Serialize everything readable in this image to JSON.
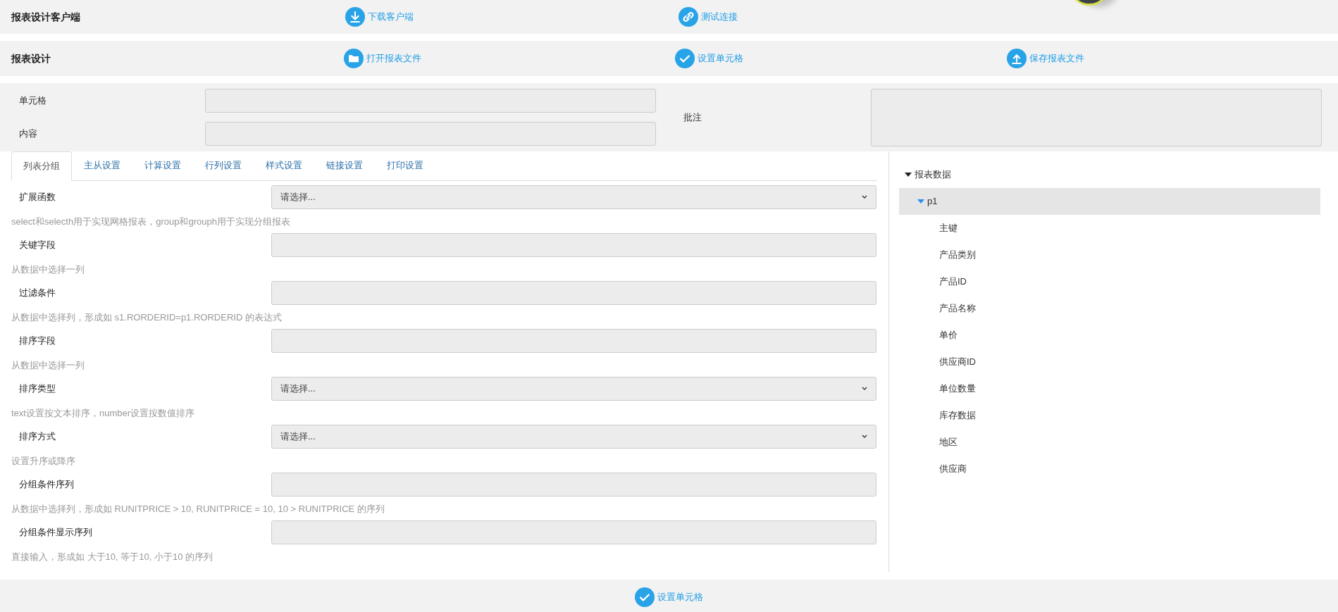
{
  "toolbars": [
    {
      "title": "报表设计客户端",
      "actions": [
        {
          "kind": "download",
          "label": "下载客户端"
        },
        {
          "kind": "link",
          "label": "测试连接"
        }
      ]
    },
    {
      "title": "报表设计",
      "actions": [
        {
          "kind": "folder",
          "label": "打开报表文件"
        },
        {
          "kind": "check",
          "label": "设置单元格"
        },
        {
          "kind": "upload",
          "label": "保存报表文件"
        }
      ]
    }
  ],
  "cell_form": {
    "cell_label": "单元格",
    "content_label": "内容",
    "note_label": "批注"
  },
  "tabs": [
    {
      "label": "列表分组",
      "selected": true
    },
    {
      "label": "主从设置",
      "selected": false
    },
    {
      "label": "计算设置",
      "selected": false
    },
    {
      "label": "行列设置",
      "selected": false
    },
    {
      "label": "样式设置",
      "selected": false
    },
    {
      "label": "链接设置",
      "selected": false
    },
    {
      "label": "打印设置",
      "selected": false
    }
  ],
  "fields": [
    {
      "kind": "select",
      "label": "扩展函数",
      "value": "请选择...",
      "hint": "select和selecth用于实现网格报表，group和grouph用于实现分组报表"
    },
    {
      "kind": "input",
      "label": "关键字段",
      "hint": "从数据中选择一列"
    },
    {
      "kind": "input",
      "label": "过滤条件",
      "hint": "从数据中选择列，形成如 s1.RORDERID=p1.RORDERID 的表达式"
    },
    {
      "kind": "input",
      "label": "排序字段",
      "hint": "从数据中选择一列"
    },
    {
      "kind": "select",
      "label": "排序类型",
      "value": "请选择...",
      "hint": "text设置按文本排序，number设置按数值排序"
    },
    {
      "kind": "select",
      "label": "排序方式",
      "value": "请选择...",
      "hint": "设置升序或降序"
    },
    {
      "kind": "input",
      "label": "分组条件序列",
      "hint": "从数据中选择列，形成如 RUNITPRICE > 10, RUNITPRICE = 10, 10 > RUNITPRICE 的序列"
    },
    {
      "kind": "input",
      "label": "分组条件显示序列",
      "hint": "直接输入，形成如 大于10, 等于10, 小于10 的序列"
    }
  ],
  "tree": {
    "label": "报表数据",
    "expanded": true,
    "children": [
      {
        "label": "p1",
        "expanded": true,
        "selected": true,
        "children": [
          {
            "label": "主键"
          },
          {
            "label": "产品类别"
          },
          {
            "label": "产品ID"
          },
          {
            "label": "产品名称"
          },
          {
            "label": "单价"
          },
          {
            "label": "供应商ID"
          },
          {
            "label": "单位数量"
          },
          {
            "label": "库存数据"
          },
          {
            "label": "地区"
          },
          {
            "label": "供应商"
          }
        ]
      }
    ]
  },
  "footer_action": {
    "kind": "check",
    "label": "设置单元格"
  }
}
